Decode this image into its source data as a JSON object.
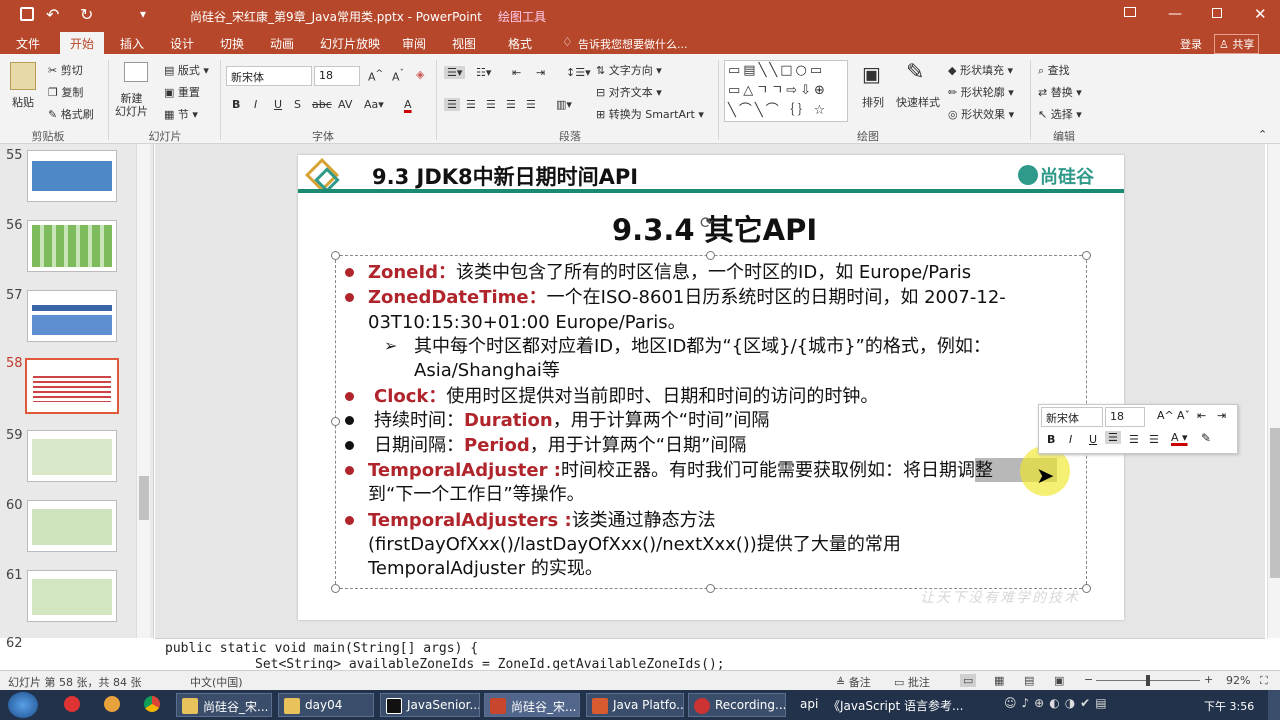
{
  "window": {
    "title": "尚硅谷_宋红康_第9章_Java常用类.pptx - PowerPoint",
    "tool_context": "绘图工具"
  },
  "tabs": [
    "文件",
    "开始",
    "插入",
    "设计",
    "切换",
    "动画",
    "幻灯片放映",
    "审阅",
    "视图",
    "格式"
  ],
  "tell_me": "告诉我您想要做什么...",
  "login": "登录",
  "share": "共享",
  "ribbon": {
    "paste": "粘贴",
    "cut": "剪切",
    "copy": "复制",
    "format_painter": "格式刷",
    "clipboard": "剪贴板",
    "new_slide": "新建\n幻灯片",
    "layout": "版式",
    "reset": "重置",
    "section": "节",
    "slides": "幻灯片",
    "font_name": "新宋体",
    "font_size": "18",
    "font": "字体",
    "text_dir": "文字方向",
    "align_text": "对齐文本",
    "smartart": "转换为 SmartArt",
    "paragraph": "段落",
    "arrange": "排列",
    "quick_styles": "快速样式",
    "shape_fill": "形状填充",
    "shape_outline": "形状轮廓",
    "shape_effects": "形状效果",
    "drawing": "绘图",
    "find": "查找",
    "replace": "替换",
    "select": "选择",
    "editing": "编辑"
  },
  "slides": [
    "55",
    "56",
    "57",
    "58",
    "59",
    "60",
    "61",
    "62"
  ],
  "slide": {
    "header": "9.3 JDK8中新日期时间API",
    "logo": "尚硅谷",
    "subtitle": "9.3.4 其它API",
    "b1_key": "ZoneId：",
    "b1_text": "该类中包含了所有的时区信息，一个时区的ID，如 Europe/Paris",
    "b2_key": "ZonedDateTime：",
    "b2_text": "一个在ISO-8601日历系统时区的日期时间，如 2007-12-",
    "b2_cont": "03T10:15:30+01:00 Europe/Paris。",
    "b2_sub1": "其中每个时区都对应着ID，地区ID都为“{区域}/{城市}”的格式，例如：",
    "b2_sub2": "Asia/Shanghai等",
    "b3_key": "Clock：",
    "b3_text": "使用时区提供对当前即时、日期和时间的访问的时钟。",
    "b4_pre": "持续时间：",
    "b4_key": "Duration",
    "b4_text": "，用于计算两个“时间”间隔",
    "b5_pre": "日期间隔：",
    "b5_key": "Period",
    "b5_text": "，用于计算两个“日期”间隔",
    "b6_key": "TemporalAdjuster :",
    "b6_text": "时间校正器。有时我们可能需要获取例如：将日期调整",
    "b6_cont": "到“下一个工作日”等操作。",
    "b7_key": "TemporalAdjusters :",
    "b7_text": "该类通过静态方法",
    "b7_cont1": "(firstDayOfXxx()/lastDayOfXxx()/nextXxx())提供了大量的常用",
    "b7_cont2": "TemporalAdjuster 的实现。",
    "watermark": "让天下没有难学的技术"
  },
  "mini_toolbar": {
    "font": "新宋体",
    "size": "18"
  },
  "notes": {
    "line1": "public static void main(String[] args) {",
    "line2": "Set<String> availableZoneIds = ZoneId.getAvailableZoneIds();"
  },
  "status": {
    "slide_count": "幻灯片 第 58 张，共 84 张",
    "language": "中文(中国)",
    "notes_btn": "备注",
    "comments_btn": "批注",
    "zoom": "92%"
  },
  "taskbar": {
    "items": [
      "尚硅谷_宋...",
      "day04",
      "JavaSenior...",
      "尚硅谷_宋...",
      "Java Platfo...",
      "Recording...",
      "api",
      "《JavaScript 语言参考..."
    ],
    "time": "下午 3:56"
  },
  "colors": {
    "accent": "#b7472a",
    "bullet_red": "#b0242b",
    "header_line": "#1a8a72"
  }
}
